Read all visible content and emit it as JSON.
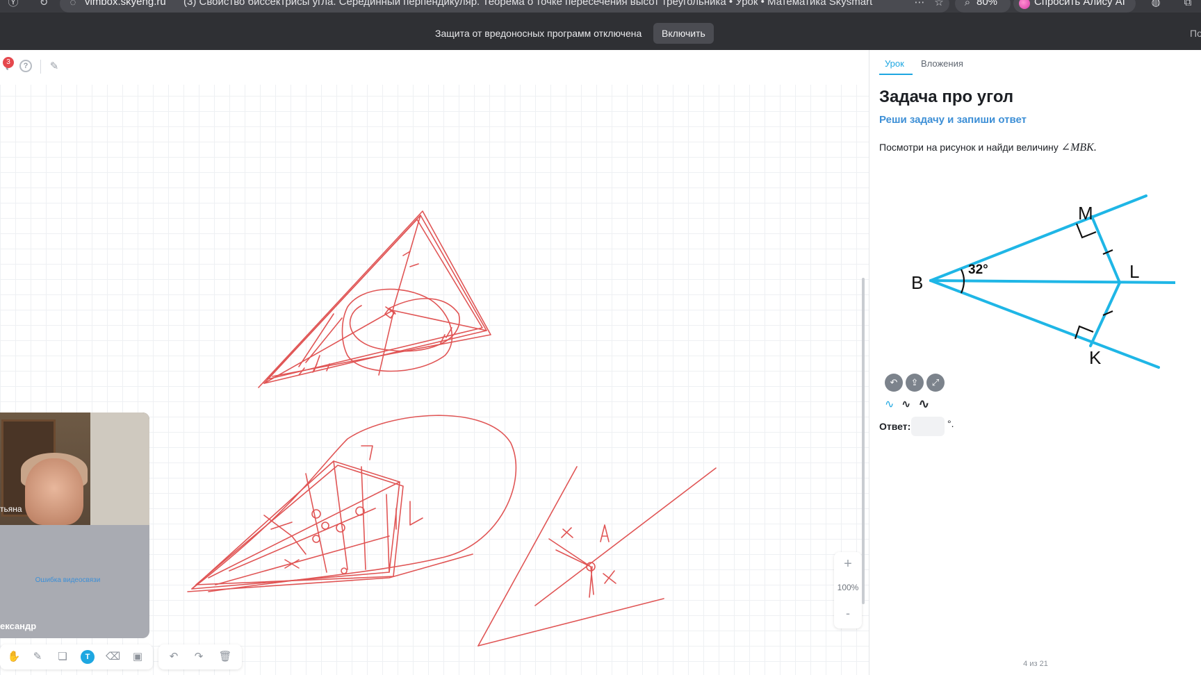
{
  "browser": {
    "address_domain": "vimbox.skyeng.ru",
    "tab_title": "(3) Свойство биссектрисы угла. Серединный перпендикуляр. Теорема о точке пересечения высот треугольника • Урок • Математика Skysmart",
    "zoom": "80%",
    "assistant_label": "Спросить Алису AI"
  },
  "banner": {
    "text": "Защита от вредоносных программ отключена",
    "button": "Включить",
    "cut_text": "По"
  },
  "board": {
    "notification_count": "3",
    "zoom_level": "100%",
    "zoom_plus": "+",
    "zoom_minus": "-"
  },
  "video": {
    "name_top": "тьяна",
    "error": "Ошибка видеосвязи",
    "name_bottom": "ександр"
  },
  "lesson": {
    "tabs": [
      "Урок",
      "Вложения"
    ],
    "title": "Задача про угол",
    "subtitle": "Реши задачу и запиши ответ",
    "text": "Посмотри на рисунок и найди величину",
    "math": "∠MBK.",
    "figure": {
      "labels": {
        "M": "M",
        "B": "B",
        "L": "L",
        "K": "K"
      },
      "angle": "32°",
      "line_color": "#1fb6e6"
    },
    "answer_label": "Ответ:",
    "answer_value": "",
    "answer_unit": "°.",
    "pager": "4 из 21"
  },
  "colors": {
    "accent": "#1ea7e1",
    "drawing": "#e05555",
    "banner_bg": "#2f3034"
  }
}
